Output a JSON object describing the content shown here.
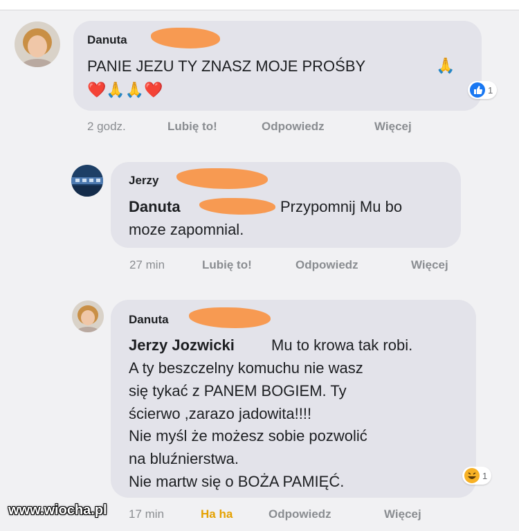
{
  "comments": [
    {
      "author": "Danuta",
      "text_lines": [
        "PANIE JEZU TY ZNASZ MOJE PROŚBY"
      ],
      "emoji_line": "❤️🙏🙏❤️",
      "reaction": {
        "icon": "like-icon",
        "count": "1"
      },
      "actions": {
        "time": "2 godz.",
        "like": "Lubię to!",
        "reply": "Odpowiedz",
        "more": "Więcej"
      }
    },
    {
      "author": "Jerzy",
      "mention": "Danuta",
      "text_first": "Przypomnij Mu bo",
      "text_lines": [
        "moze zapomnial."
      ],
      "actions": {
        "time": "27 min",
        "like": "Lubię to!",
        "reply": "Odpowiedz",
        "more": "Więcej"
      }
    },
    {
      "author": "Danuta",
      "mention": "Jerzy Jozwicki",
      "text_first": "Mu to krowa tak robi.",
      "text_lines": [
        "A ty beszczelny komuchu nie wasz",
        "się tykać z PANEM BOGIEM. Ty",
        "ścierwo ,zarazo jadowita!!!!",
        "Nie myśl że możesz sobie pozwolić",
        "na bluźnierstwa.",
        "Nie martw się o BOŻA PAMIĘĆ."
      ],
      "reaction": {
        "icon": "haha-icon",
        "count": "1"
      },
      "actions": {
        "time": "17 min",
        "like": "Ha ha",
        "reply": "Odpowiedz",
        "more": "Więcej"
      }
    }
  ],
  "watermark": "www.wiocha.pl",
  "colors": {
    "bubble": "#e3e3ea",
    "redaction": "#f79a52",
    "like_blue": "#1877f2",
    "haha_yellow": "#f7b125"
  }
}
